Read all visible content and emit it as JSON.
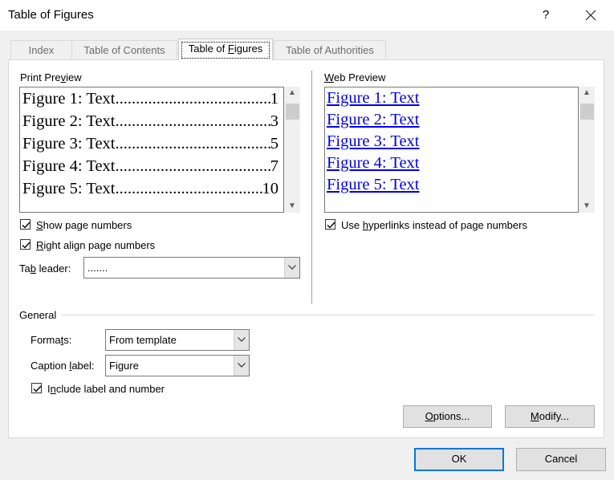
{
  "window": {
    "title": "Table of Figures",
    "help": "?",
    "close_icon": "close-icon"
  },
  "tabs": [
    {
      "label": "Index"
    },
    {
      "label": "Table of Contents"
    },
    {
      "label": "Table of Figures",
      "active": true
    },
    {
      "label": "Table of Authorities"
    }
  ],
  "print_preview": {
    "label": "Print Preview",
    "entries": [
      {
        "text": "Figure 1: Text",
        "page": "1"
      },
      {
        "text": "Figure 2: Text",
        "page": "3"
      },
      {
        "text": "Figure 3: Text",
        "page": "5"
      },
      {
        "text": "Figure 4: Text",
        "page": "7"
      },
      {
        "text": "Figure 5: Text",
        "page": "10"
      }
    ]
  },
  "web_preview": {
    "label": "Web Preview",
    "entries": [
      "Figure 1: Text",
      "Figure 2: Text",
      "Figure 3: Text",
      "Figure 4: Text",
      "Figure 5: Text"
    ],
    "link_color": "#0000ee"
  },
  "options": {
    "show_page_numbers": {
      "label": "Show page numbers",
      "checked": true
    },
    "right_align": {
      "label": "Right align page numbers",
      "checked": true
    },
    "tab_leader": {
      "label": "Tab leader:",
      "value": "......."
    },
    "use_hyperlinks": {
      "label": "Use hyperlinks instead of page numbers",
      "checked": true
    }
  },
  "general": {
    "label": "General",
    "formats": {
      "label": "Formats:",
      "value": "From template"
    },
    "caption_label": {
      "label": "Caption label:",
      "value": "Figure"
    },
    "include_label": {
      "label": "Include label and number",
      "checked": true
    }
  },
  "buttons": {
    "options": "Options...",
    "modify": "Modify...",
    "ok": "OK",
    "cancel": "Cancel"
  },
  "colors": {
    "accent": "#0078d7",
    "panel": "#ffffff",
    "window_bg": "#f0f0f0"
  }
}
